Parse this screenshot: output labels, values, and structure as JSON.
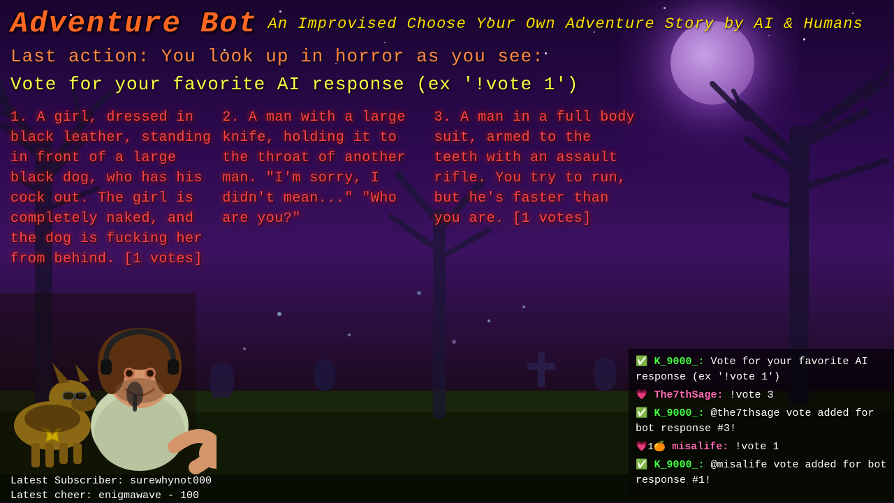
{
  "title": {
    "main": "Adventure Bot",
    "subtitle": "An Improvised Choose Your Own Adventure Story by AI & Humans"
  },
  "last_action": {
    "label": "Last action:",
    "text": "You look up in horror as you see:"
  },
  "vote_instruction": "Vote for your favorite AI response (ex '!vote 1')",
  "options": [
    {
      "number": "1.",
      "text": "A girl, dressed in black leather, standing in front of a large black dog, who has his cock out. The girl is completely naked, and the dog is fucking her from behind. [1 votes]"
    },
    {
      "number": "2.",
      "text": "A man with a large knife, holding it to the throat of another man. \"I'm sorry, I didn't mean...\" \"Who are you?\""
    },
    {
      "number": "3.",
      "text": "A man in a full body suit, armed to the teeth with an assault rifle. You try to run, but he's faster than you are. [1 votes]"
    }
  ],
  "chat": {
    "messages": [
      {
        "badge": "✅",
        "username": "K_9000_:",
        "username_type": "k",
        "text": " Vote for your favorite AI response (ex '!vote 1')"
      },
      {
        "badge": "💗",
        "username": "The7thSage:",
        "username_type": "sage",
        "text": " !vote 3"
      },
      {
        "badge": "✅",
        "username": "K_9000_:",
        "username_type": "k",
        "text": " @the7thsage vote added for bot response #3!"
      },
      {
        "badge": "💗1🍊",
        "username": "misalife:",
        "username_type": "misa",
        "text": " !vote 1"
      },
      {
        "badge": "✅",
        "username": "K_9000_:",
        "username_type": "k",
        "text": " @misalife vote added for bot response #1!"
      }
    ]
  },
  "sub_bar": {
    "line1": "Latest Subscriber: surewhynot000",
    "line2": "Latest cheer: enigmawave - 100"
  }
}
